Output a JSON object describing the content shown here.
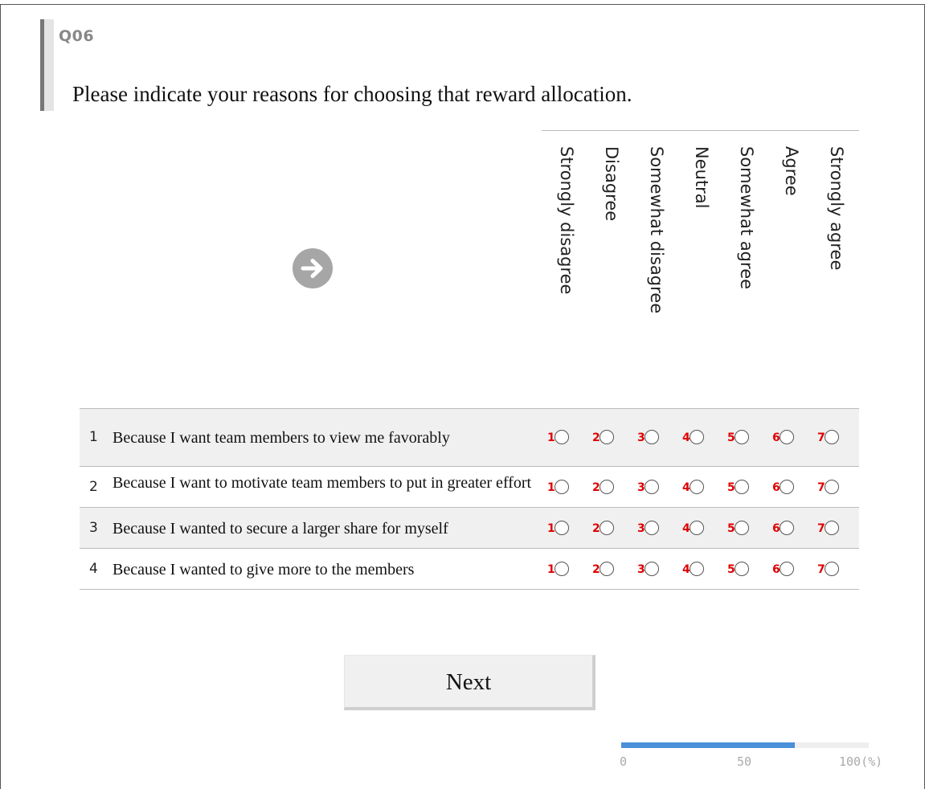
{
  "question": {
    "number": "Q06",
    "text": "Please indicate your reasons for choosing that reward allocation."
  },
  "scale": {
    "columns": [
      "Strongly disagree",
      "Disagree",
      "Somewhat disagree",
      "Neutral",
      "Somewhat agree",
      "Agree",
      "Strongly agree"
    ],
    "option_numbers": [
      "1",
      "2",
      "3",
      "4",
      "5",
      "6",
      "7"
    ]
  },
  "items": [
    {
      "num": "1",
      "text": "Because I want team members to view me favorably"
    },
    {
      "num": "2",
      "text": "Because I want to motivate team members to put in greater effort"
    },
    {
      "num": "3",
      "text": "Because I wanted to secure a larger share for myself"
    },
    {
      "num": "4",
      "text": "Because I wanted to give more to the members"
    }
  ],
  "next_button": {
    "label": "Next"
  },
  "progress": {
    "percent": 70,
    "label_0": "0",
    "label_50": "50",
    "label_100": "100(%)"
  },
  "colors": {
    "accent": "#4a8fd8",
    "option_number": "#e00000"
  }
}
